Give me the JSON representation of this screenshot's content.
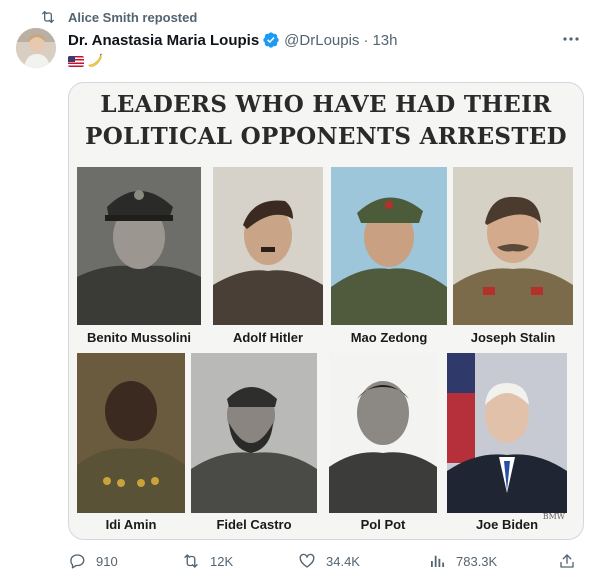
{
  "repost": {
    "icon": "repost-icon",
    "text": "Alice Smith reposted"
  },
  "post": {
    "author_name": "Dr. Anastasia Maria Loupis",
    "handle": "@DrLoupis",
    "separator": "·",
    "time": "13h",
    "verified_icon": "verified-badge-icon",
    "emoji": [
      "us-flag-icon",
      "banana-icon"
    ]
  },
  "media": {
    "title_line1": "LEADERS WHO HAVE HAD THEIR",
    "title_line2": "POLITICAL OPPONENTS ARRESTED",
    "leaders": [
      "Benito Mussolini",
      "Adolf Hitler",
      "Mao Zedong",
      "Joseph Stalin",
      "Idi Amin",
      "Fidel Castro",
      "Pol Pot",
      "Joe Biden"
    ],
    "watermark": "BMW"
  },
  "actions": {
    "replies": "910",
    "reposts": "12K",
    "likes": "34.4K",
    "views": "783.3K"
  },
  "colors": {
    "muted": "#536471",
    "verified": "#1d9bf0",
    "border": "#cfd9de"
  }
}
